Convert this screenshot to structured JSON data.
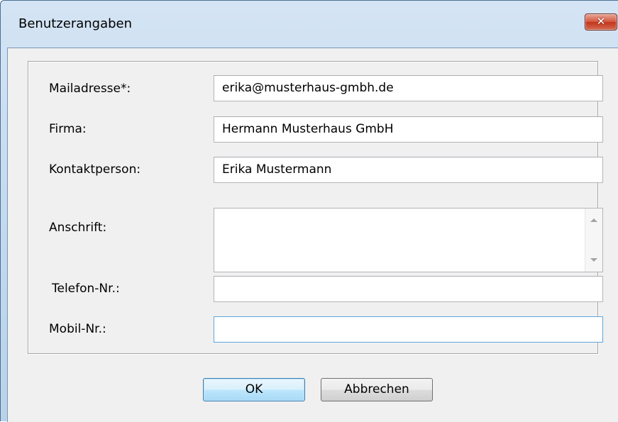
{
  "window": {
    "title": "Benutzerangaben",
    "close_glyph": "✕",
    "accent_color": "#c2d8ee"
  },
  "form": {
    "email": {
      "label": "Mailadresse*:",
      "value": "erika@musterhaus-gmbh.de"
    },
    "company": {
      "label": "Firma:",
      "value": "Hermann Musterhaus GmbH"
    },
    "contact": {
      "label": "Kontaktperson:",
      "value": "Erika Mustermann"
    },
    "address": {
      "label": "Anschrift:",
      "value": ""
    },
    "phone": {
      "label": "Telefon-Nr.:",
      "value": ""
    },
    "mobile": {
      "label": "Mobil-Nr.:",
      "value": ""
    }
  },
  "buttons": {
    "ok": "OK",
    "cancel": "Abbrechen"
  }
}
